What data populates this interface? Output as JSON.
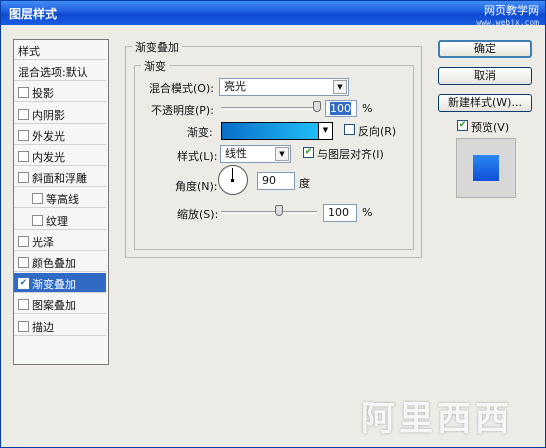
{
  "window": {
    "title": "图层样式",
    "watermark": "网页教学网",
    "watermark_url": "www.webjx.com"
  },
  "styles_panel": {
    "items": [
      {
        "label": "样式",
        "type": "head"
      },
      {
        "label": "混合选项:默认",
        "type": "head"
      },
      {
        "label": "投影",
        "checked": false
      },
      {
        "label": "内阴影",
        "checked": false
      },
      {
        "label": "外发光",
        "checked": false
      },
      {
        "label": "内发光",
        "checked": false
      },
      {
        "label": "斜面和浮雕",
        "checked": false
      },
      {
        "label": "等高线",
        "checked": false,
        "sub": true
      },
      {
        "label": "纹理",
        "checked": false,
        "sub": true
      },
      {
        "label": "光泽",
        "checked": false
      },
      {
        "label": "颜色叠加",
        "checked": false
      },
      {
        "label": "渐变叠加",
        "checked": true,
        "active": true
      },
      {
        "label": "图案叠加",
        "checked": false
      },
      {
        "label": "描边",
        "checked": false
      }
    ]
  },
  "main": {
    "group_title": "渐变叠加",
    "sub_title": "渐变",
    "blend_mode_label": "混合模式(O):",
    "blend_mode_value": "亮光",
    "opacity_label": "不透明度(P):",
    "opacity_value": "100",
    "opacity_unit": "%",
    "opacity_level": 1.0,
    "gradient_label": "渐变:",
    "reverse_label": "反向(R)",
    "reverse_checked": false,
    "style_label": "样式(L):",
    "style_value": "线性",
    "align_label": "与图层对齐(I)",
    "align_checked": true,
    "angle_label": "角度(N):",
    "angle_value": "90",
    "angle_unit": "度",
    "scale_label": "缩放(S):",
    "scale_value": "100",
    "scale_unit": "%",
    "scale_level": 0.5,
    "gradient_colors": [
      "#0a6ec8",
      "#22c8ff"
    ]
  },
  "buttons": {
    "ok": "确定",
    "cancel": "取消",
    "new_style": "新建样式(W)...",
    "preview_label": "预览(V)",
    "preview_checked": true
  },
  "logo_text": "阿里西西"
}
